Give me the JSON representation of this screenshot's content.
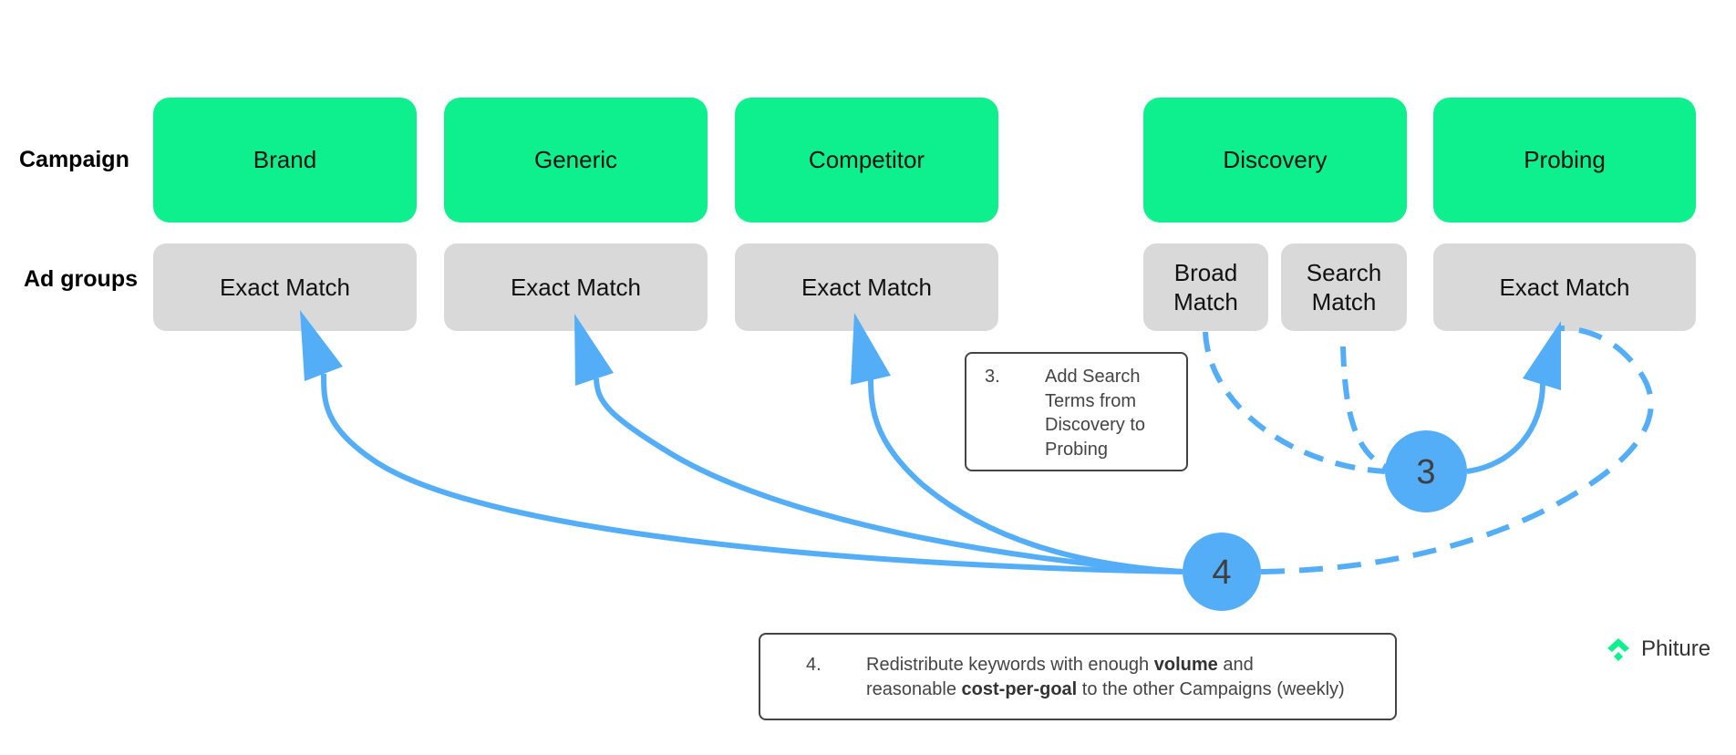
{
  "row_labels": {
    "campaign": "Campaign",
    "ad_groups": "Ad groups"
  },
  "campaigns": [
    {
      "label": "Brand"
    },
    {
      "label": "Generic"
    },
    {
      "label": "Competitor"
    },
    {
      "label": "Discovery"
    },
    {
      "label": "Probing"
    }
  ],
  "ad_groups": [
    {
      "campaign": "Brand",
      "label": "Exact Match"
    },
    {
      "campaign": "Generic",
      "label": "Exact Match"
    },
    {
      "campaign": "Competitor",
      "label": "Exact Match"
    },
    {
      "campaign": "Discovery",
      "label_line1": "Broad",
      "label_line2": "Match"
    },
    {
      "campaign": "Discovery",
      "label_line1": "Search",
      "label_line2": "Match"
    },
    {
      "campaign": "Probing",
      "label": "Exact Match"
    }
  ],
  "steps": {
    "step3": {
      "badge": "3",
      "number": "3.",
      "lines": [
        "Add Search",
        "Terms from",
        "Discovery to",
        "Probing"
      ]
    },
    "step4": {
      "badge": "4",
      "number": "4.",
      "line1_a": "Redistribute keywords with enough ",
      "line1_bold": "volume",
      "line1_b": " and",
      "line2_a": "reasonable ",
      "line2_bold": "cost-per-goal",
      "line2_b": " to the other Campaigns (weekly)"
    }
  },
  "connections": [
    {
      "from": "step4",
      "to": "Brand Exact Match",
      "style": "solid"
    },
    {
      "from": "step4",
      "to": "Generic Exact Match",
      "style": "solid"
    },
    {
      "from": "step4",
      "to": "Competitor Exact Match",
      "style": "solid"
    },
    {
      "from": "step4",
      "to": "Probing Exact Match",
      "style": "dashed"
    },
    {
      "from": "Broad Match",
      "to": "step3",
      "style": "dashed"
    },
    {
      "from": "Search Match",
      "to": "step3",
      "style": "dashed"
    },
    {
      "from": "step3",
      "to": "Probing Exact Match",
      "style": "solid"
    }
  ],
  "brand": {
    "logo_text": "Phiture",
    "logo_icon": "phiture-chevron-icon"
  },
  "colors": {
    "campaign_fill": "#0EF08E",
    "adgroup_fill": "#D9D9D9",
    "flow_blue": "#54AEF7",
    "note_border": "#444444"
  }
}
